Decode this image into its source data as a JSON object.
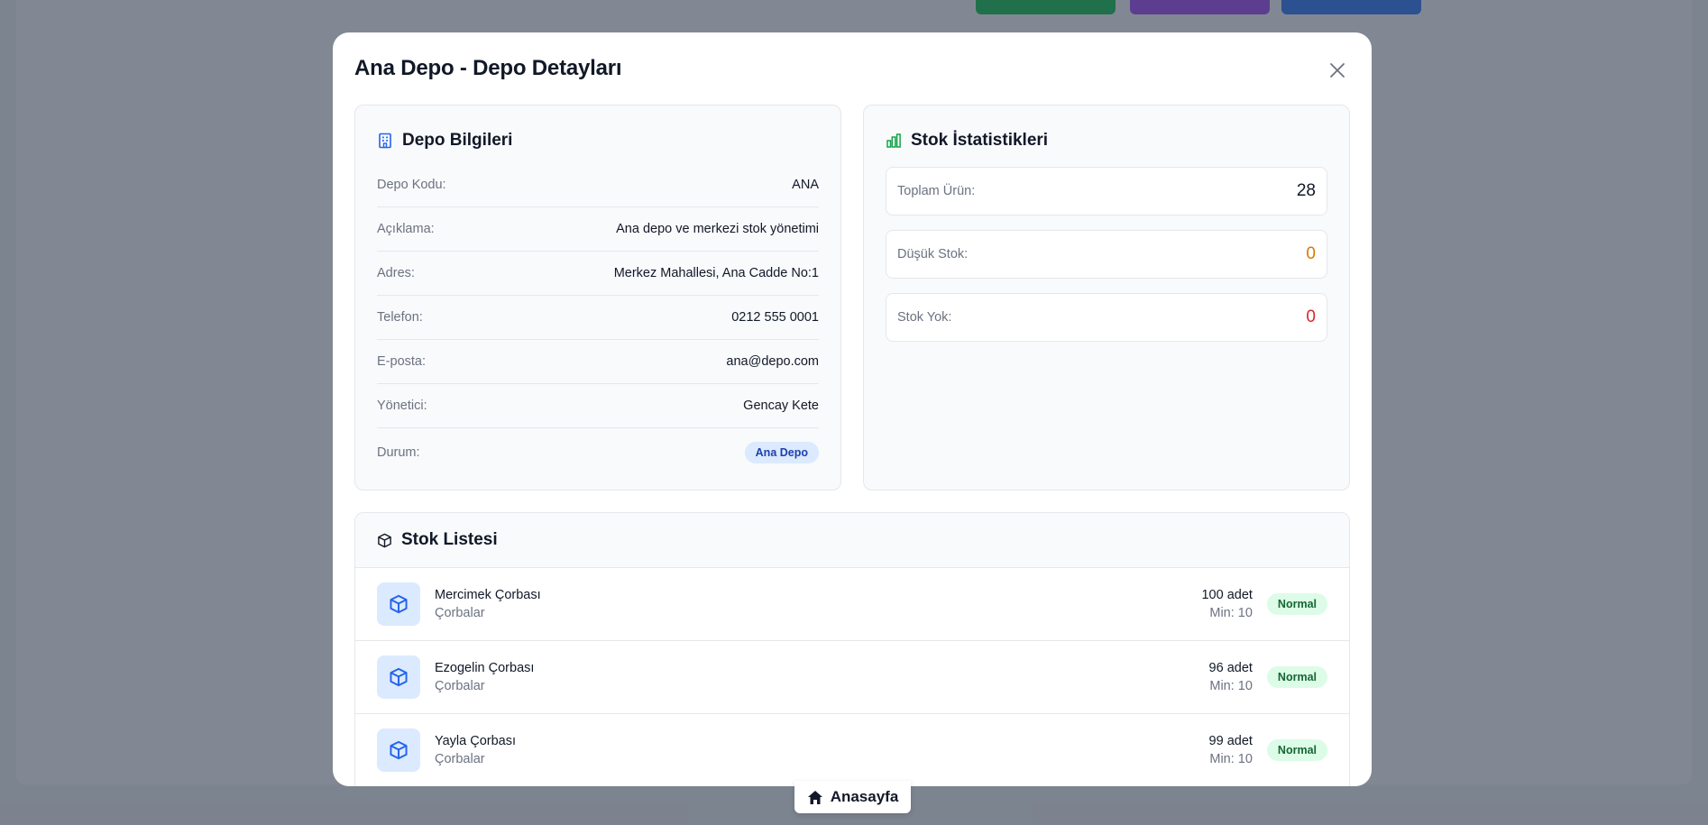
{
  "modal": {
    "title": "Ana Depo - Depo Detayları"
  },
  "depo_bilgileri": {
    "heading": "Depo Bilgileri",
    "rows": [
      {
        "label": "Depo Kodu:",
        "value": "ANA"
      },
      {
        "label": "Açıklama:",
        "value": "Ana depo ve merkezi stok yönetimi"
      },
      {
        "label": "Adres:",
        "value": "Merkez Mahallesi, Ana Cadde No:1"
      },
      {
        "label": "Telefon:",
        "value": "0212 555 0001"
      },
      {
        "label": "E-posta:",
        "value": "ana@depo.com"
      },
      {
        "label": "Yönetici:",
        "value": "Gencay Kete"
      }
    ],
    "status_label": "Durum:",
    "status_badge": "Ana Depo"
  },
  "stok_istatistikleri": {
    "heading": "Stok İstatistikleri",
    "toplam_label": "Toplam Ürün:",
    "toplam_value": "28",
    "dusuk_label": "Düşük Stok:",
    "dusuk_value": "0",
    "yok_label": "Stok Yok:",
    "yok_value": "0",
    "colors": {
      "total": "#111827",
      "low": "#d97706",
      "none": "#dc2626"
    }
  },
  "stok_listesi": {
    "heading": "Stok Listesi",
    "items": [
      {
        "name": "Mercimek Çorbası",
        "category": "Çorbalar",
        "qty": "100 adet",
        "min": "Min: 10",
        "status": "Normal"
      },
      {
        "name": "Ezogelin Çorbası",
        "category": "Çorbalar",
        "qty": "96 adet",
        "min": "Min: 10",
        "status": "Normal"
      },
      {
        "name": "Yayla Çorbası",
        "category": "Çorbalar",
        "qty": "99 adet",
        "min": "Min: 10",
        "status": "Normal"
      }
    ]
  },
  "footer": {
    "home_label": "Anasayfa"
  },
  "icons": {
    "building": "building-icon",
    "chart": "bar-chart-icon",
    "box": "box-icon",
    "home": "home-icon",
    "close": "close-icon"
  }
}
